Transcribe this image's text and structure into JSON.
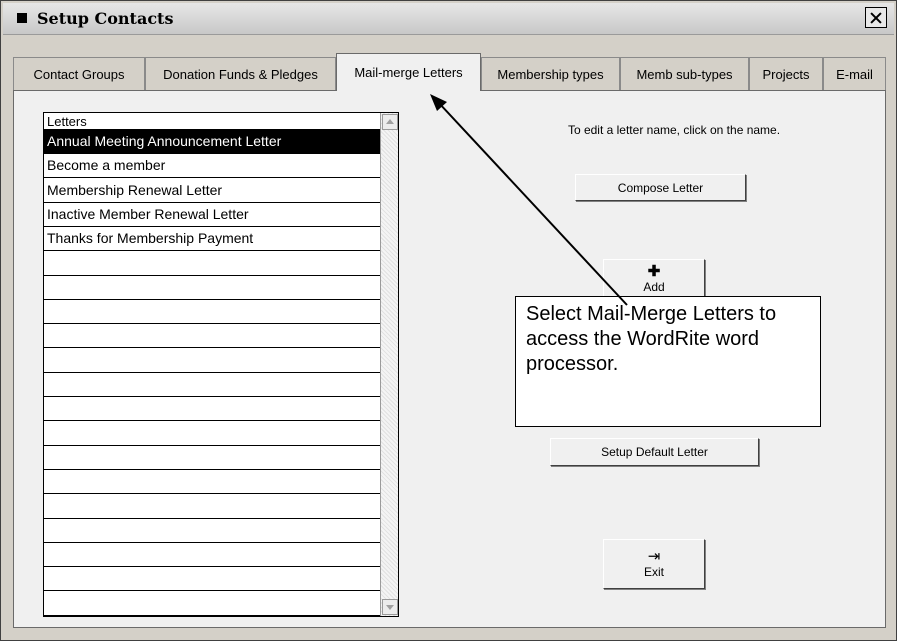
{
  "window": {
    "title": "Setup Contacts"
  },
  "tabs": [
    {
      "label": "Contact Groups",
      "active": false
    },
    {
      "label": "Donation Funds & Pledges",
      "active": false
    },
    {
      "label": "Mail-merge Letters",
      "active": true
    },
    {
      "label": "Membership types",
      "active": false
    },
    {
      "label": "Memb sub-types",
      "active": false
    },
    {
      "label": "Projects",
      "active": false
    },
    {
      "label": "E-mail",
      "active": false
    }
  ],
  "letters": {
    "header": "Letters",
    "items": [
      "Annual Meeting Announcement Letter",
      "Become a member",
      "Membership Renewal Letter",
      "Inactive Member Renewal Letter",
      "Thanks for Membership Payment",
      "",
      "",
      "",
      "",
      "",
      "",
      "",
      "",
      "",
      "",
      "",
      "",
      "",
      "",
      ""
    ],
    "selected_index": 0
  },
  "hint_text": "To edit a letter name, click on the name.",
  "buttons": {
    "compose": "Compose Letter",
    "add": "Add",
    "setup_default": "Setup Default Letter",
    "exit": "Exit"
  },
  "callout": {
    "text": "Select Mail-Merge Letters to access the WordRite word processor."
  },
  "icons": {
    "close": "close-icon",
    "add": "plus-icon",
    "exit": "exit-door-icon"
  }
}
